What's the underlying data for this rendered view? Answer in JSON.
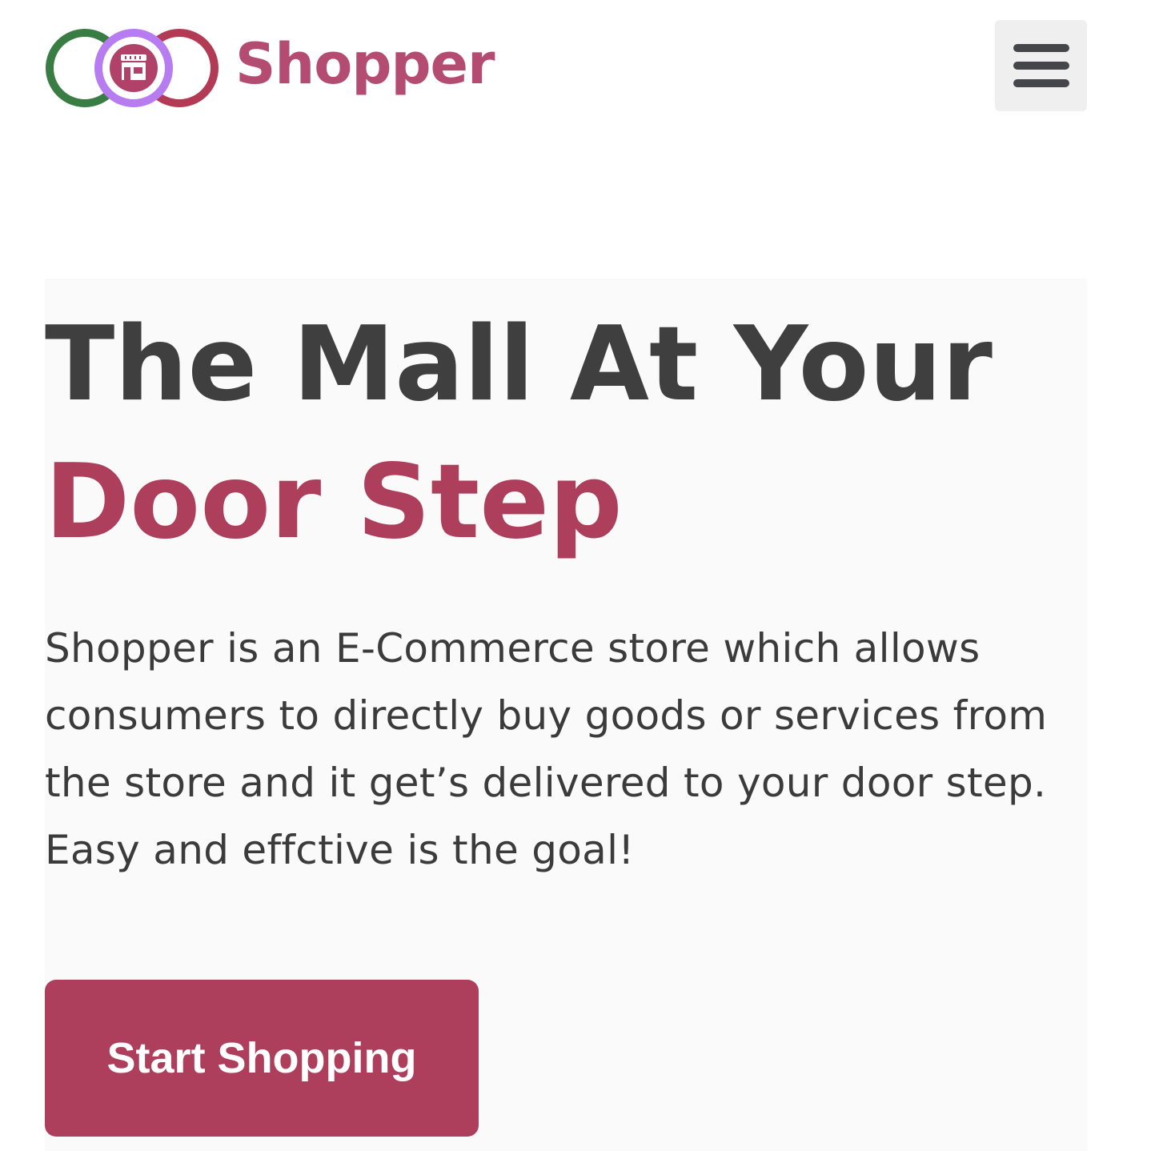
{
  "header": {
    "brand_name": "Shopper",
    "logo_icon": "storefront-icon",
    "menu_icon": "hamburger-menu-icon"
  },
  "hero": {
    "title_line1": "The Mall At Your",
    "title_line2": "Door Step",
    "description": "Shopper is an E-Commerce store which allows consumers to directly buy goods or services from the store and it get’s delivered to your door step. Easy and effctive is the goal!",
    "cta_label": "Start Shopping"
  },
  "colors": {
    "brand": "#ad3e5c",
    "heading": "#3f3f3f",
    "text": "#3b3b3b",
    "ring_green": "#3a7d44",
    "ring_purple": "#b77cf0",
    "ring_red": "#b23a55",
    "menu_bg": "#efefef",
    "hero_bg": "#fafafa"
  }
}
